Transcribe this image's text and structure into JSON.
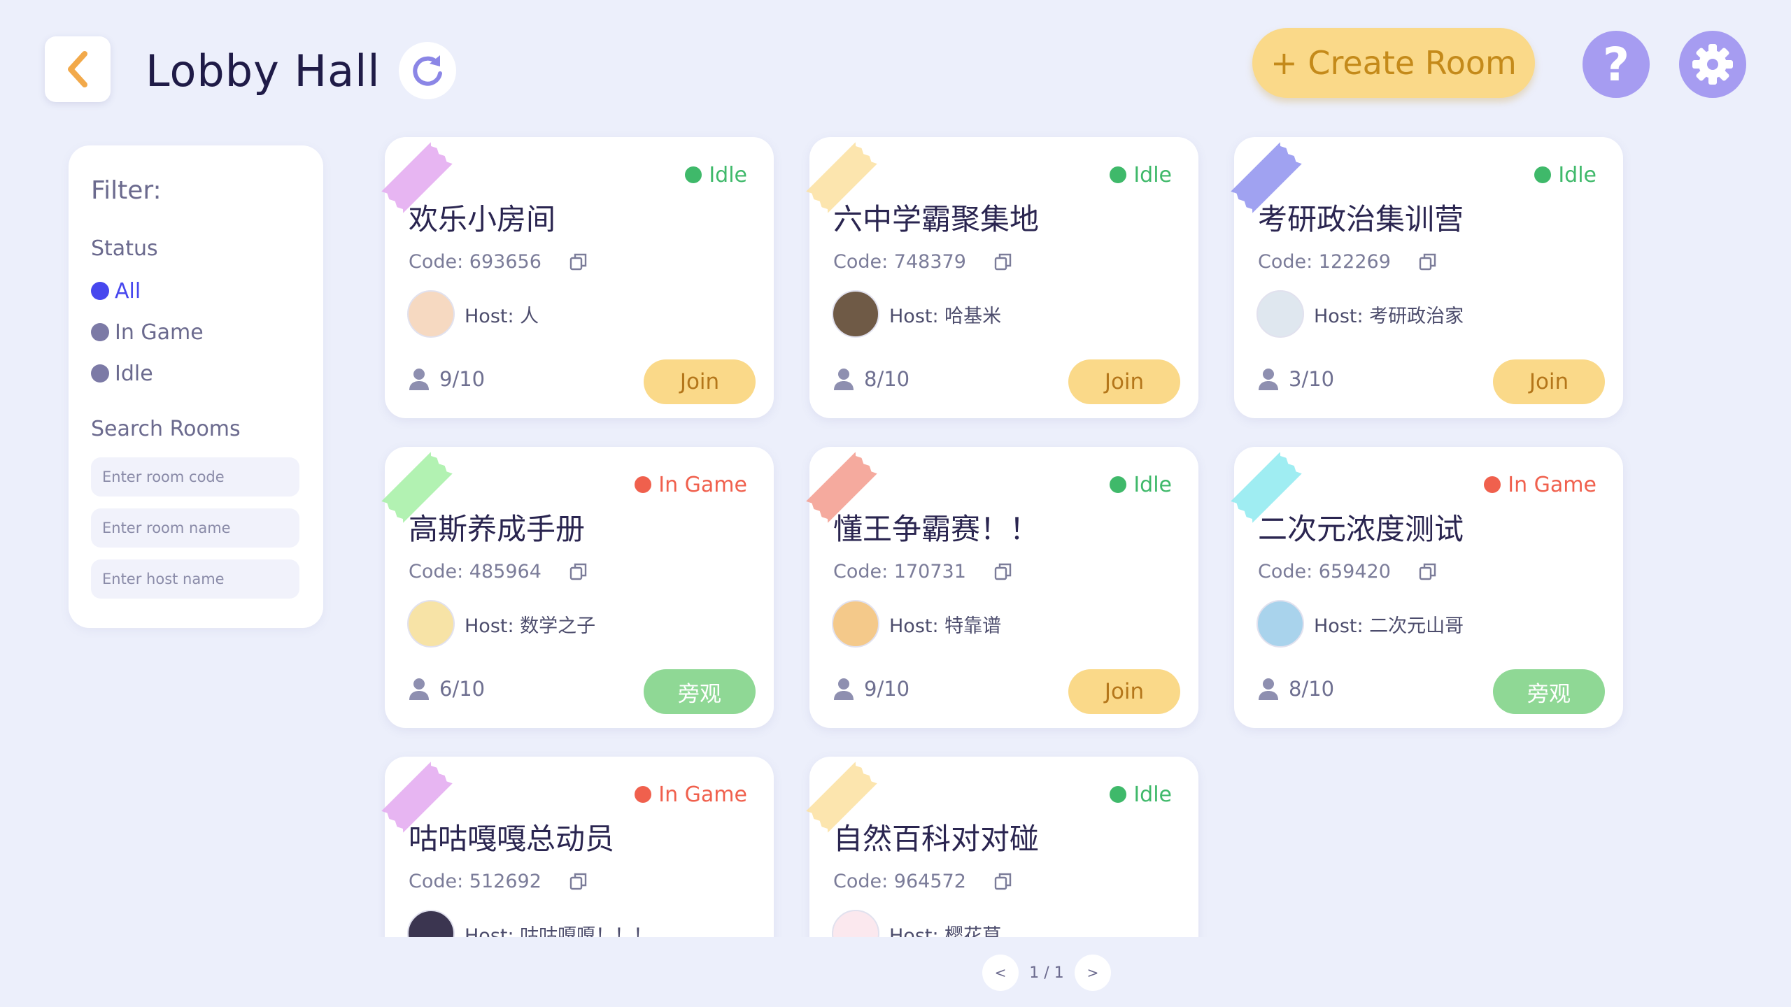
{
  "header": {
    "title": "Lobby Hall",
    "create_room_label": "+ Create Room",
    "help_label": "?"
  },
  "filter": {
    "title": "Filter:",
    "status_label": "Status",
    "status_options": [
      "All",
      "In Game",
      "Idle"
    ],
    "selected_status": "All",
    "search_label": "Search Rooms",
    "search_fields": [
      {
        "placeholder": "Enter room code",
        "value": ""
      },
      {
        "placeholder": "Enter room name",
        "value": ""
      },
      {
        "placeholder": "Enter host name",
        "value": ""
      }
    ]
  },
  "rooms": [
    {
      "name": "欢乐小房间",
      "code": "Code: 693656",
      "host": "Host: 人",
      "players": "9/10",
      "status": "Idle",
      "action": "Join",
      "tape_color": "#e3a8f0",
      "avatar_color": "#f6d9c1"
    },
    {
      "name": "六中学霸聚集地",
      "code": "Code: 748379",
      "host": "Host: 哈基米",
      "players": "8/10",
      "status": "Idle",
      "action": "Join",
      "tape_color": "#fbe0a0",
      "avatar_color": "#6f5a46"
    },
    {
      "name": "考研政治集训营",
      "code": "Code: 122269",
      "host": "Host: 考研政治家",
      "players": "3/10",
      "status": "Idle",
      "action": "Join",
      "tape_color": "#8f92ee",
      "avatar_color": "#dfe7ef"
    },
    {
      "name": "高斯养成手册",
      "code": "Code: 485964",
      "host": "Host: 数学之子",
      "players": "6/10",
      "status": "In Game",
      "action": "旁观",
      "tape_color": "#a5f0a5",
      "avatar_color": "#f7e3a6"
    },
    {
      "name": "懂王争霸赛！！",
      "code": "Code: 170731",
      "host": "Host: 特靠谱",
      "players": "9/10",
      "status": "Idle",
      "action": "Join",
      "tape_color": "#f39b8d",
      "avatar_color": "#f4c98a"
    },
    {
      "name": "二次元浓度测试",
      "code": "Code: 659420",
      "host": "Host: 二次元山哥",
      "players": "8/10",
      "status": "In Game",
      "action": "旁观",
      "tape_color": "#8eeaf0",
      "avatar_color": "#a9d3ec"
    },
    {
      "name": "咕咕嘎嘎总动员",
      "code": "Code: 512692",
      "host": "Host: 咕咕嘎嘎！！！",
      "players": "",
      "status": "In Game",
      "action": "",
      "tape_color": "#e3a8f0",
      "avatar_color": "#3b3550"
    },
    {
      "name": "自然百科对对碰",
      "code": "Code: 964572",
      "host": "Host: 樱花草",
      "players": "",
      "status": "Idle",
      "action": "",
      "tape_color": "#fbe0a0",
      "avatar_color": "#fbe8ee"
    }
  ],
  "pagination": {
    "prev_label": "<",
    "page_text": "1 / 1",
    "next_label": ">"
  },
  "colors": {
    "background": "#eceffb",
    "accent_yellow": "#fad989",
    "accent_purple": "#a69cf1",
    "idle_green": "#3fb96a",
    "ingame_red": "#f0604d",
    "selected_blue": "#4747ee"
  },
  "icons": {
    "back": "chevron-left-icon",
    "refresh": "refresh-icon",
    "help": "question-mark-icon",
    "settings": "gear-icon",
    "copy": "copy-icon",
    "players": "person-icon"
  }
}
